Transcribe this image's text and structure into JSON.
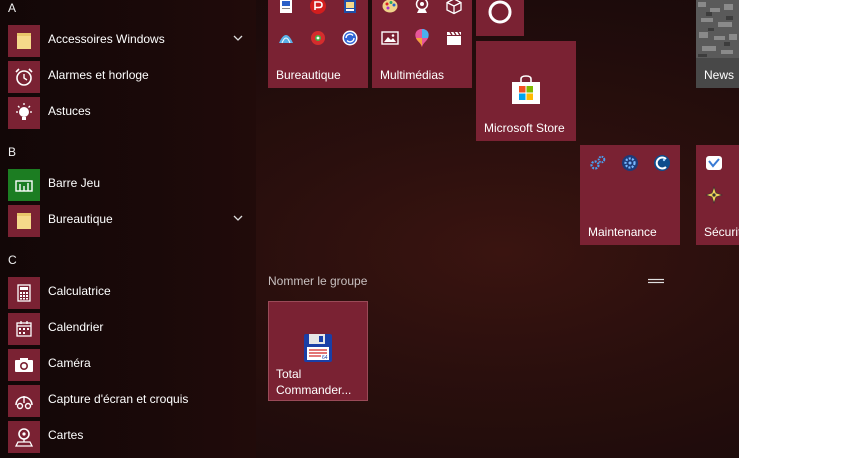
{
  "sections": [
    {
      "letter": "A",
      "apps": [
        {
          "label": "Accessoires Windows",
          "icon": "folder-icon",
          "expandable": true
        },
        {
          "label": "Alarmes et horloge",
          "icon": "alarm-clock-icon",
          "expandable": false
        },
        {
          "label": "Astuces",
          "icon": "lightbulb-icon",
          "expandable": false
        }
      ]
    },
    {
      "letter": "B",
      "apps": [
        {
          "label": "Barre Jeu",
          "icon": "xbox-game-bar-icon",
          "expandable": false
        },
        {
          "label": "Bureautique",
          "icon": "folder-icon",
          "expandable": true
        }
      ]
    },
    {
      "letter": "C",
      "apps": [
        {
          "label": "Calculatrice",
          "icon": "calculator-icon",
          "expandable": false
        },
        {
          "label": "Calendrier",
          "icon": "calendar-icon",
          "expandable": false
        },
        {
          "label": "Caméra",
          "icon": "camera-icon",
          "expandable": false
        },
        {
          "label": "Capture d'écran et croquis",
          "icon": "snip-sketch-icon",
          "expandable": false
        },
        {
          "label": "Cartes",
          "icon": "maps-icon",
          "expandable": false
        }
      ]
    }
  ],
  "tiles": {
    "bureautique": "Bureautique",
    "multimedias": "Multimédias",
    "store": "Microsoft Store",
    "news": "News",
    "maintenance": "Maintenance",
    "securite": "Sécurit",
    "total_commander_line1": "Total",
    "total_commander_line2": "Commander..."
  },
  "group_name_placeholder": "Nommer le groupe",
  "colors": {
    "tile": "#7a2233",
    "green": "#1c7d22",
    "folder": "#f5d98a"
  }
}
